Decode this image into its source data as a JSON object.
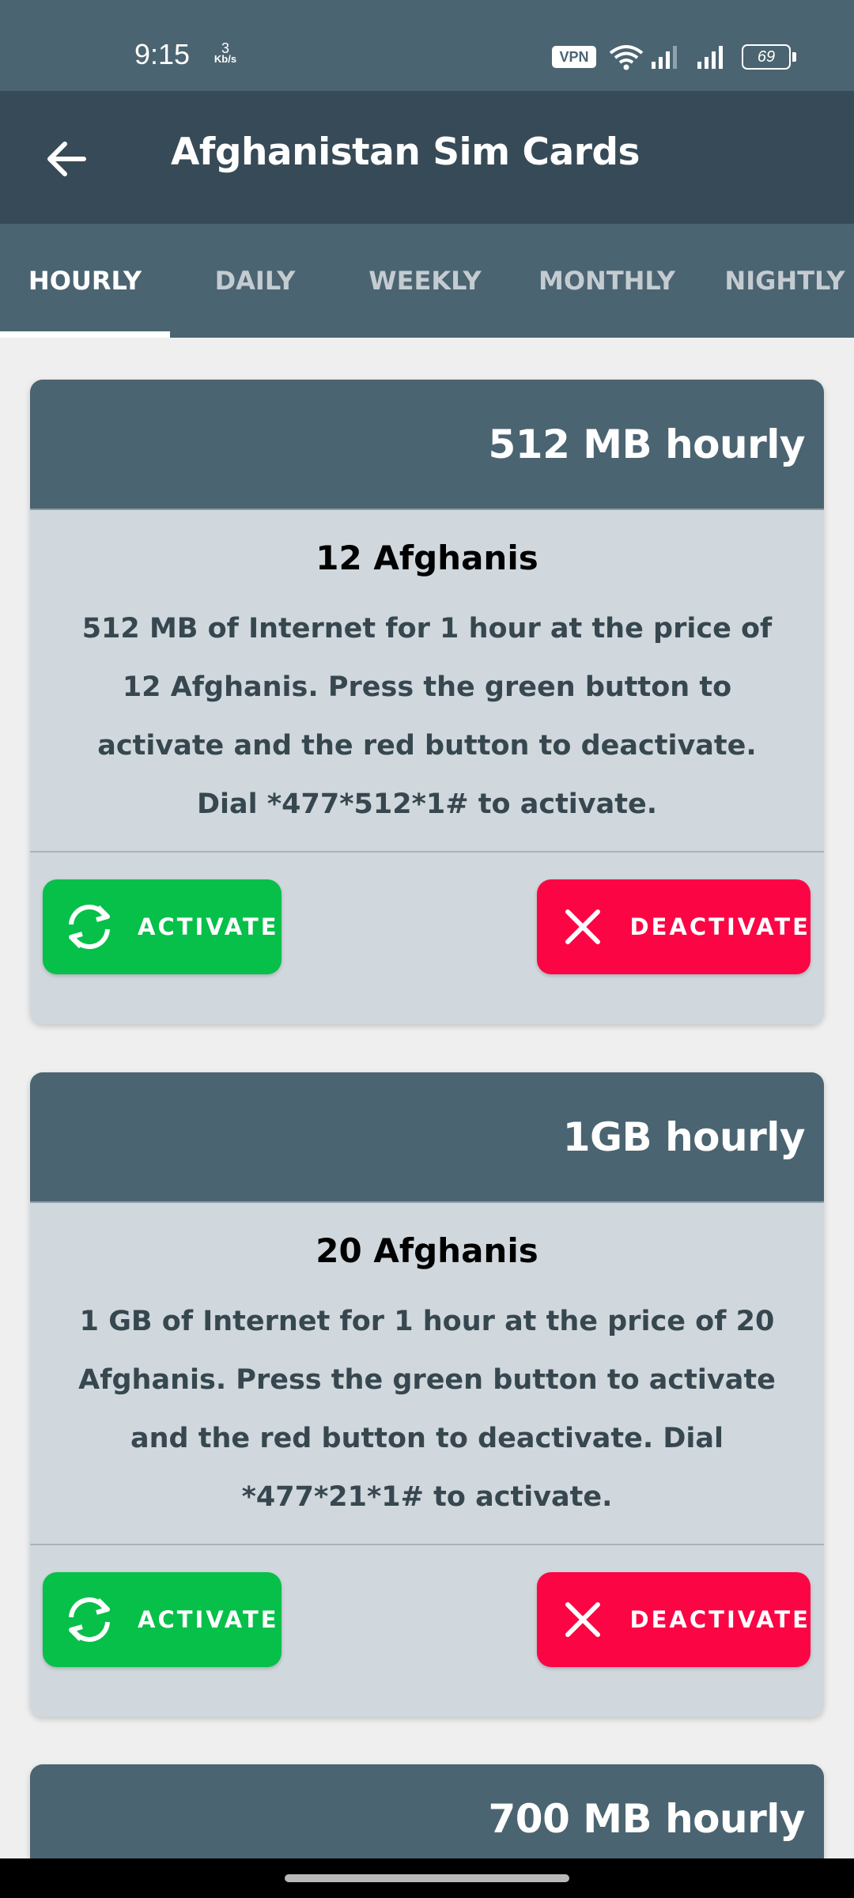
{
  "status_bar": {
    "time": "9:15",
    "speed_value": "3",
    "speed_unit": "Kb/s",
    "vpn": "VPN",
    "battery": "69"
  },
  "app_bar": {
    "title": "Afghanistan Sim Cards"
  },
  "tabs": [
    {
      "label": "HOURLY",
      "active": true
    },
    {
      "label": "DAILY",
      "active": false
    },
    {
      "label": "WEEKLY",
      "active": false
    },
    {
      "label": "MONTHLY",
      "active": false
    },
    {
      "label": "NIGHTLY",
      "active": false
    }
  ],
  "cards": [
    {
      "title": "512 MB hourly",
      "price": "12 Afghanis",
      "description": "512 MB of Internet for 1 hour at the price of 12 Afghanis. Press the green button to activate and the red button to deactivate. Dial *477*512*1# to activate.",
      "activate_label": "ACTIVATE",
      "deactivate_label": "DEACTIVATE"
    },
    {
      "title": "1GB hourly",
      "price": "20 Afghanis",
      "description": "1 GB of Internet for 1 hour at the price of 20 Afghanis. Press the green button to activate and the red button to deactivate. Dial *477*21*1# to activate.",
      "activate_label": "ACTIVATE",
      "deactivate_label": "DEACTIVATE"
    },
    {
      "title": "700 MB hourly"
    }
  ],
  "colors": {
    "primary": "#4b6471",
    "primary_dark": "#374a57",
    "card_body": "#d0d8dd",
    "activate": "#06c04a",
    "deactivate": "#fc0545"
  },
  "icons": {
    "back": "arrow-left-icon",
    "activate": "refresh-icon",
    "deactivate": "close-icon"
  }
}
